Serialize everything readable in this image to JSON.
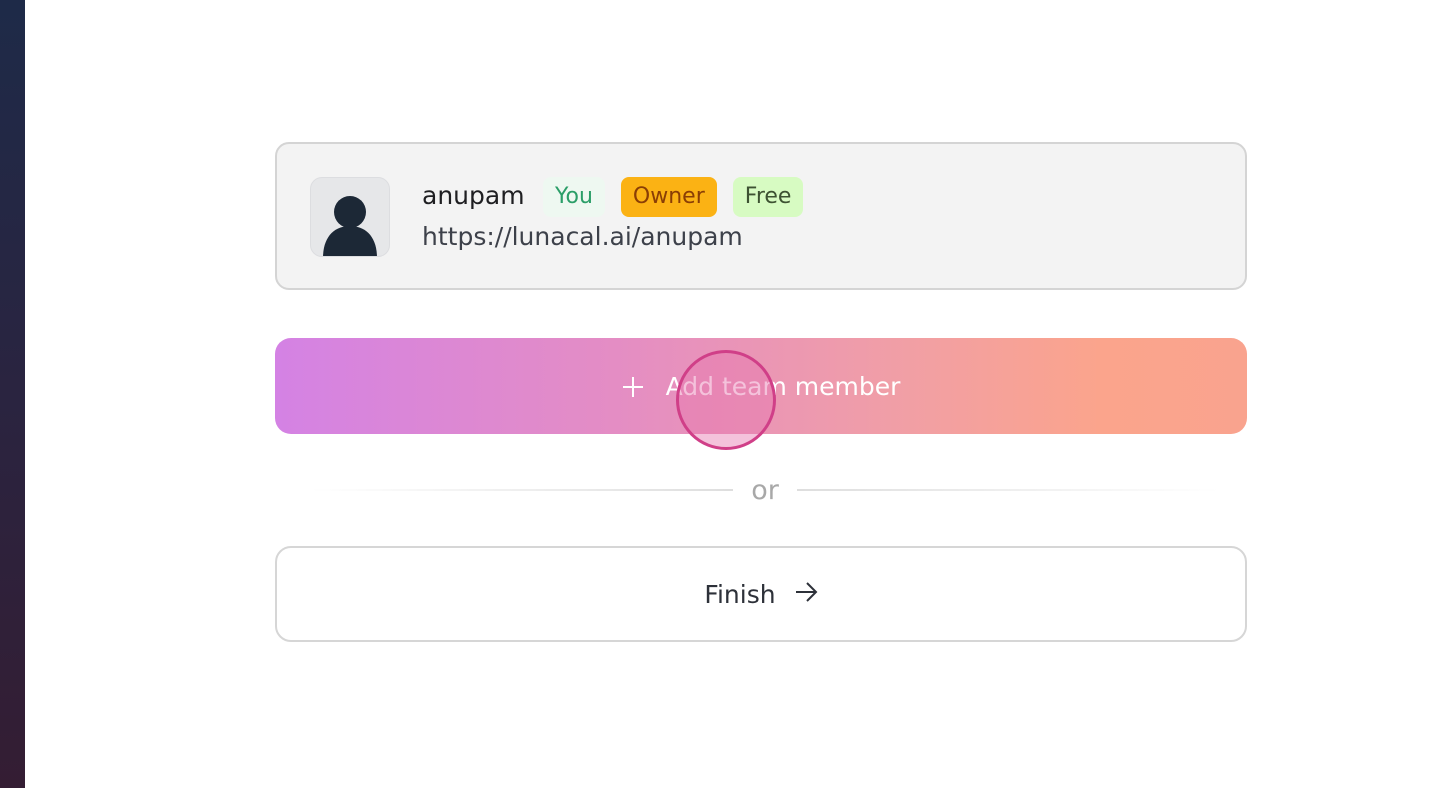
{
  "member": {
    "name": "anupam",
    "url": "https://lunacal.ai/anupam",
    "avatar_icon": "user-silhouette-icon",
    "badges": [
      {
        "label": "You",
        "color": "#2b9e68",
        "bg": "#eef8f1"
      },
      {
        "label": "Owner",
        "color": "#8a3e05",
        "bg": "#fbb214"
      },
      {
        "label": "Free",
        "color": "#3d5232",
        "bg": "#d7fbc2"
      }
    ]
  },
  "actions": {
    "add_member_label": "Add team member",
    "add_member_icon": "plus-icon",
    "divider_text": "or",
    "finish_label": "Finish",
    "finish_icon": "arrow-right-icon"
  },
  "colors": {
    "gradient_start": "#d482e4",
    "gradient_end": "#f9a38e",
    "cursor_ring": "#d03f88"
  }
}
